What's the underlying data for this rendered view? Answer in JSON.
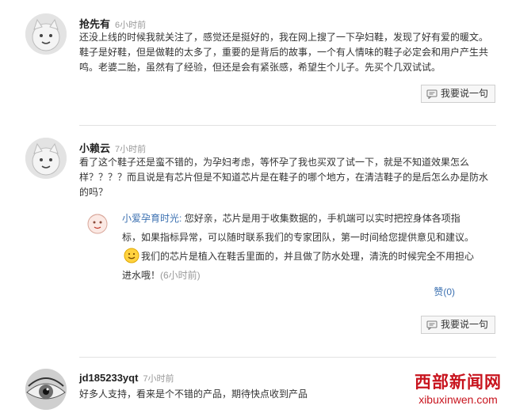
{
  "comments": [
    {
      "user": "抢先有",
      "time": "6小时前",
      "text": "还没上线的时候我就关注了，感觉还是挺好的，我在网上搜了一下孕妇鞋，发现了好有爱的暖文。鞋子是好鞋，但是做鞋的太多了，重要的是背后的故事，一个有人情味的鞋子必定会和用户产生共鸣。老婆二胎，虽然有了经验，但还是会有紧张感，希望生个儿子。先买个几双试试。",
      "avatar_icon": "cartoon-face-icon",
      "reply_label": "我要说一句"
    },
    {
      "user": "小赖云",
      "time": "7小时前",
      "text": "看了这个鞋子还是蛮不错的，为孕妇考虑，等怀孕了我也买双了试一下，就是不知道效果怎么样？？？？而且说是有芯片但是不知道芯片是在鞋子的哪个地方，在清洁鞋子的是后怎么办是防水的吗？",
      "avatar_icon": "cartoon-face-icon",
      "reply_label": "我要说一句",
      "sub_reply": {
        "user": "小爱孕育时光:",
        "text_part1": "您好亲，芯片是用于收集数据的，手机端可以实时把控身体各项指标，如果指标异常，可以随时联系我们的专家团队，第一时间给您提供意见和建议。",
        "text_part2": "我们的芯片是植入在鞋舌里面的，并且做了防水处理，清洗的时候完全不用担心进水哦！",
        "time": "(6小时前)",
        "like_label": "赞(0)"
      }
    },
    {
      "user": "jd185233yqt",
      "time": "7小时前",
      "text": "好多人支持，看来是个不错的产品，期待快点收到产品",
      "avatar_icon": "eye-photo-icon"
    }
  ],
  "watermark": {
    "cn": "西部新闻网",
    "en": "xibuxinwen.com"
  },
  "colors": {
    "link": "#3a6fb0",
    "watermark": "#c8141e",
    "divider": "#e2e2e2"
  }
}
